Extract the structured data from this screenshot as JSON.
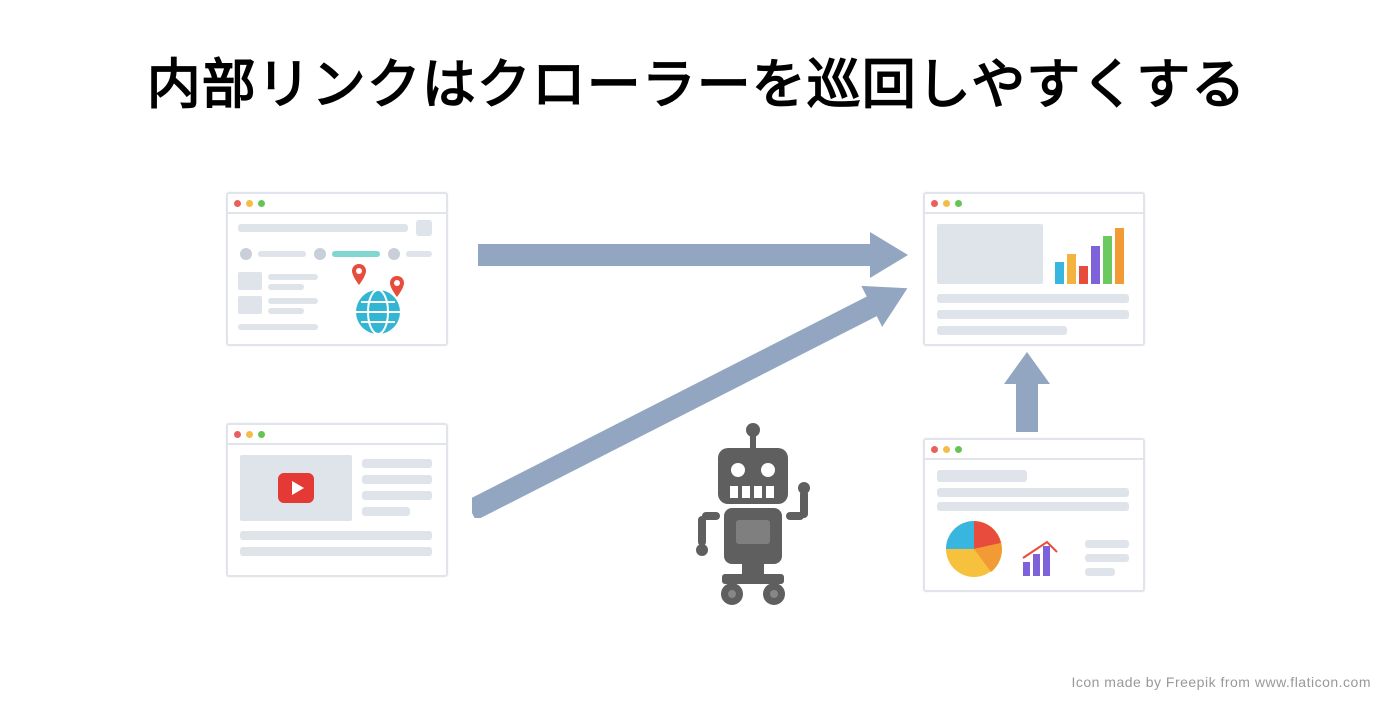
{
  "title": "内部リンクはクローラーを巡回しやすくする",
  "credit": "Icon made by Freepik from www.flaticon.com",
  "colors": {
    "arrow": "#92a6c1",
    "window_border": "#e1e4ea",
    "placeholder": "#dfe3ea",
    "robot": "#5f5f5f",
    "globe": "#33b6d4",
    "pin": "#e74c3c",
    "play": "#e53935",
    "bar_colors": [
      "#38b6e0",
      "#f4b23e",
      "#e74c3c",
      "#7d62d9",
      "#6bc95f",
      "#f29a33"
    ],
    "pie_colors": [
      "#38b6e0",
      "#f6c23e",
      "#e74c3c",
      "#f29a33"
    ]
  },
  "icons": {
    "robot": "robot-icon",
    "globe": "globe-icon",
    "pins": "map-pin-icon",
    "video": "play-icon",
    "bars": "bar-chart-icon",
    "pie": "pie-chart-icon"
  }
}
